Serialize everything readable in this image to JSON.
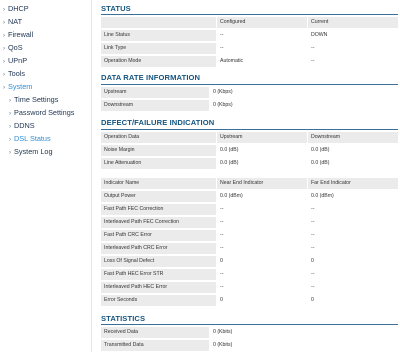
{
  "nav": {
    "items": [
      "DHCP",
      "NAT",
      "Firewall",
      "QoS",
      "UPnP",
      "Tools",
      "System"
    ],
    "sub_items": [
      "Time Settings",
      "Password Settings",
      "DDNS",
      "DSL Status",
      "System Log"
    ]
  },
  "status": {
    "title": "STATUS",
    "headers": [
      "Configured",
      "Current"
    ],
    "rows": [
      {
        "label": "Line Status",
        "configured": "--",
        "current": "DOWN"
      },
      {
        "label": "Link Type",
        "configured": "--",
        "current": "--"
      },
      {
        "label": "Operation Mode",
        "configured": "Automatic",
        "current": "--"
      }
    ]
  },
  "data_rate": {
    "title": "DATA RATE INFORMATION",
    "rows": [
      {
        "label": "Upstream",
        "value": "0 (Kbps)"
      },
      {
        "label": "Downstream",
        "value": "0 (Kbps)"
      }
    ]
  },
  "defect": {
    "title": "DEFECT/FAILURE INDICATION",
    "table1": {
      "headers": [
        "Operation Data",
        "Upstream",
        "Downstream"
      ],
      "rows": [
        {
          "label": "Noise Margin",
          "up": "0.0 (dB)",
          "down": "0.0 (dB)"
        },
        {
          "label": "Line Attenuation",
          "up": "0.0 (dB)",
          "down": "0.0 (dB)"
        }
      ]
    },
    "table2": {
      "headers": [
        "Indicator Name",
        "Near End Indicator",
        "Far End Indicator"
      ],
      "rows": [
        {
          "label": "Output Power",
          "near": "0.0 (dBm)",
          "far": "0.0 (dBm)"
        },
        {
          "label": "Fast Path FEC Correction",
          "near": "--",
          "far": "--"
        },
        {
          "label": "Interleaved Path FEC Correction",
          "near": "--",
          "far": "--"
        },
        {
          "label": "Fast Path CRC Error",
          "near": "--",
          "far": "--"
        },
        {
          "label": "Interleaved Path CRC Error",
          "near": "--",
          "far": "--"
        },
        {
          "label": "Loss Of Signal Defect",
          "near": "0",
          "far": "0"
        },
        {
          "label": "Fast Path HEC Error STR",
          "near": "--",
          "far": "--"
        },
        {
          "label": "Interleaved Path HEC Error",
          "near": "--",
          "far": "--"
        },
        {
          "label": "Error Seconds",
          "near": "0",
          "far": "0"
        }
      ]
    }
  },
  "statistics": {
    "title": "STATISTICS",
    "rows": [
      {
        "label": "Received Data",
        "value": "0 (Kbits)"
      },
      {
        "label": "Transmitted Data",
        "value": "0 (Kbits)"
      }
    ]
  }
}
